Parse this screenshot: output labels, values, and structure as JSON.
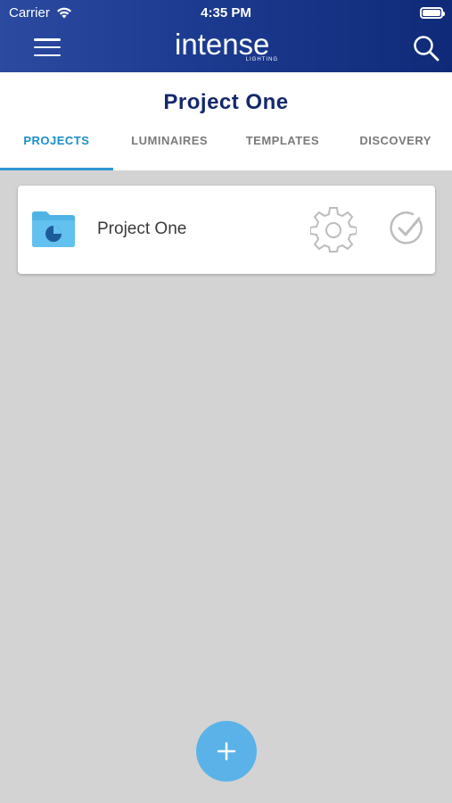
{
  "status_bar": {
    "carrier": "Carrier",
    "time": "4:35 PM"
  },
  "header": {
    "logo_text": "intense",
    "logo_subtext": "LIGHTING",
    "icons": {
      "menu": "hamburger-icon",
      "search": "search-icon"
    }
  },
  "page": {
    "title": "Project One"
  },
  "tabs": [
    {
      "label": "PROJECTS",
      "active": true
    },
    {
      "label": "LUMINAIRES",
      "active": false
    },
    {
      "label": "TEMPLATES",
      "active": false
    },
    {
      "label": "DISCOVERY",
      "active": false
    }
  ],
  "projects": [
    {
      "name": "Project One",
      "icons": [
        "folder-icon",
        "gear-icon",
        "check-circle-icon"
      ]
    }
  ],
  "fab": {
    "label": "+"
  },
  "colors": {
    "header_start": "#2b4aa0",
    "header_end": "#0f2a78",
    "title": "#14286d",
    "active_tab": "#1a8ec9",
    "background": "#d3d3d3",
    "fab": "#5bb2e8"
  }
}
